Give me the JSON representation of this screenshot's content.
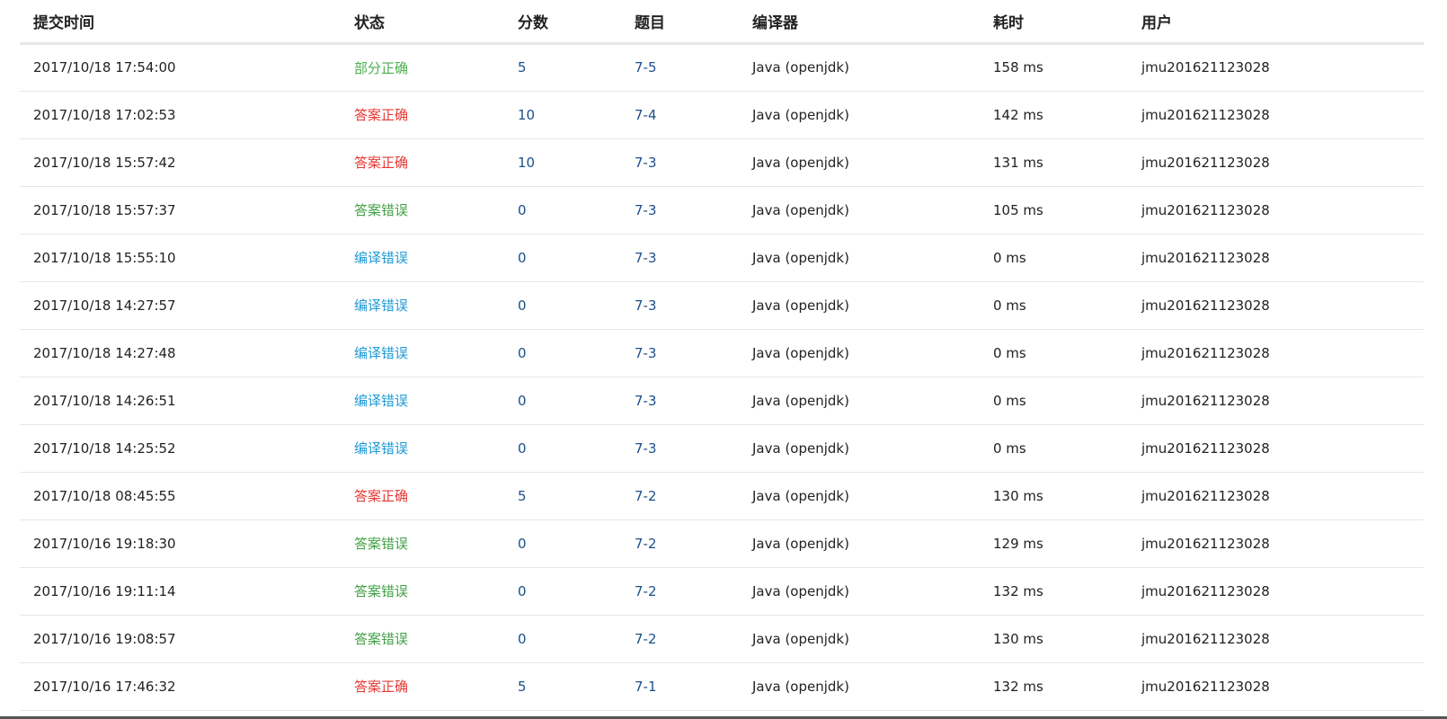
{
  "table": {
    "headers": {
      "submit_time": "提交时间",
      "status": "状态",
      "score": "分数",
      "problem": "题目",
      "compiler": "编译器",
      "time_cost": "耗时",
      "user": "用户"
    },
    "rows": [
      {
        "submit_time": "2017/10/18 17:54:00",
        "status": "部分正确",
        "status_type": "partial",
        "score": "5",
        "problem": "7-5",
        "compiler": "Java (openjdk)",
        "time_cost": "158 ms",
        "user": "jmu201621123028"
      },
      {
        "submit_time": "2017/10/18 17:02:53",
        "status": "答案正确",
        "status_type": "accepted",
        "score": "10",
        "problem": "7-4",
        "compiler": "Java (openjdk)",
        "time_cost": "142 ms",
        "user": "jmu201621123028"
      },
      {
        "submit_time": "2017/10/18 15:57:42",
        "status": "答案正确",
        "status_type": "accepted",
        "score": "10",
        "problem": "7-3",
        "compiler": "Java (openjdk)",
        "time_cost": "131 ms",
        "user": "jmu201621123028"
      },
      {
        "submit_time": "2017/10/18 15:57:37",
        "status": "答案错误",
        "status_type": "wrong",
        "score": "0",
        "problem": "7-3",
        "compiler": "Java (openjdk)",
        "time_cost": "105 ms",
        "user": "jmu201621123028"
      },
      {
        "submit_time": "2017/10/18 15:55:10",
        "status": "编译错误",
        "status_type": "compile",
        "score": "0",
        "problem": "7-3",
        "compiler": "Java (openjdk)",
        "time_cost": "0 ms",
        "user": "jmu201621123028"
      },
      {
        "submit_time": "2017/10/18 14:27:57",
        "status": "编译错误",
        "status_type": "compile",
        "score": "0",
        "problem": "7-3",
        "compiler": "Java (openjdk)",
        "time_cost": "0 ms",
        "user": "jmu201621123028"
      },
      {
        "submit_time": "2017/10/18 14:27:48",
        "status": "编译错误",
        "status_type": "compile",
        "score": "0",
        "problem": "7-3",
        "compiler": "Java (openjdk)",
        "time_cost": "0 ms",
        "user": "jmu201621123028"
      },
      {
        "submit_time": "2017/10/18 14:26:51",
        "status": "编译错误",
        "status_type": "compile",
        "score": "0",
        "problem": "7-3",
        "compiler": "Java (openjdk)",
        "time_cost": "0 ms",
        "user": "jmu201621123028"
      },
      {
        "submit_time": "2017/10/18 14:25:52",
        "status": "编译错误",
        "status_type": "compile",
        "score": "0",
        "problem": "7-3",
        "compiler": "Java (openjdk)",
        "time_cost": "0 ms",
        "user": "jmu201621123028"
      },
      {
        "submit_time": "2017/10/18 08:45:55",
        "status": "答案正确",
        "status_type": "accepted",
        "score": "5",
        "problem": "7-2",
        "compiler": "Java (openjdk)",
        "time_cost": "130 ms",
        "user": "jmu201621123028"
      },
      {
        "submit_time": "2017/10/16 19:18:30",
        "status": "答案错误",
        "status_type": "wrong",
        "score": "0",
        "problem": "7-2",
        "compiler": "Java (openjdk)",
        "time_cost": "129 ms",
        "user": "jmu201621123028"
      },
      {
        "submit_time": "2017/10/16 19:11:14",
        "status": "答案错误",
        "status_type": "wrong",
        "score": "0",
        "problem": "7-2",
        "compiler": "Java (openjdk)",
        "time_cost": "132 ms",
        "user": "jmu201621123028"
      },
      {
        "submit_time": "2017/10/16 19:08:57",
        "status": "答案错误",
        "status_type": "wrong",
        "score": "0",
        "problem": "7-2",
        "compiler": "Java (openjdk)",
        "time_cost": "130 ms",
        "user": "jmu201621123028"
      },
      {
        "submit_time": "2017/10/16 17:46:32",
        "status": "答案正确",
        "status_type": "accepted",
        "score": "5",
        "problem": "7-1",
        "compiler": "Java (openjdk)",
        "time_cost": "132 ms",
        "user": "jmu201621123028"
      }
    ]
  },
  "colors": {
    "partial": "#4caf50",
    "accepted": "#e53935",
    "wrong": "#43a047",
    "compile": "#1e9ad6",
    "link": "#1b4f8a"
  }
}
